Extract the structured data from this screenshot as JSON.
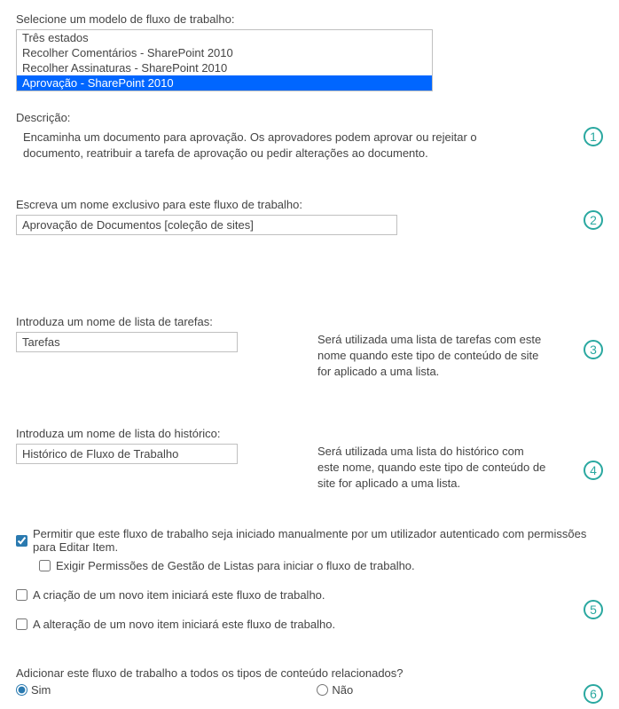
{
  "templateSelect": {
    "label": "Selecione um modelo de fluxo de trabalho:",
    "items": [
      "Três estados",
      "Recolher Comentários - SharePoint 2010",
      "Recolher Assinaturas - SharePoint 2010",
      "Aprovação - SharePoint 2010"
    ],
    "selectedIndex": 3
  },
  "description": {
    "label": "Descrição:",
    "text": "Encaminha um documento para aprovação. Os aprovadores podem aprovar ou rejeitar o documento, reatribuir a tarefa de aprovação ou pedir alterações ao documento."
  },
  "nameField": {
    "label": "Escreva um nome exclusivo para este fluxo de trabalho:",
    "value": "Aprovação de Documentos [coleção de sites]"
  },
  "taskList": {
    "label": "Introduza um nome de lista de tarefas:",
    "value": "Tarefas",
    "helper": "Será utilizada uma lista de tarefas com este nome quando este tipo de conteúdo de site for aplicado a uma lista."
  },
  "historyList": {
    "label": "Introduza um nome de lista do histórico:",
    "value": "Histórico de Fluxo de Trabalho",
    "helper": "Será utilizada uma lista do histórico com este nome, quando este tipo de conteúdo de site for aplicado a uma lista."
  },
  "options": {
    "manualStart": "Permitir que este fluxo de trabalho seja iniciado manualmente por um utilizador autenticado com permissões para Editar Item.",
    "requireManage": "Exigir Permissões de Gestão de Listas para iniciar o fluxo de trabalho.",
    "onCreate": "A criação de um novo item iniciará este fluxo de trabalho.",
    "onChange": "A alteração de um novo item iniciará este fluxo de trabalho."
  },
  "addToAll": {
    "label": "Adicionar este fluxo de trabalho a todos os tipos de conteúdo relacionados?",
    "yes": "Sim",
    "no": "Não"
  },
  "callouts": [
    "1",
    "2",
    "3",
    "4",
    "5",
    "6"
  ]
}
